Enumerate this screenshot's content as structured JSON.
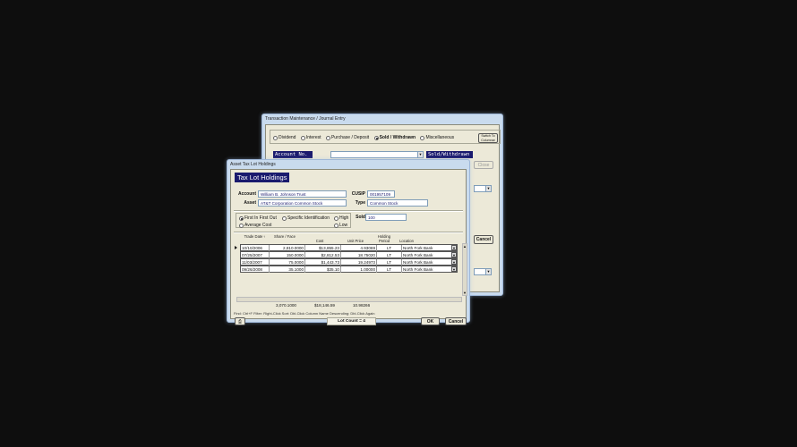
{
  "tm": {
    "title": "Transaction Maintenance / Journal Entry",
    "radios": [
      {
        "label": "Dividend",
        "on": false
      },
      {
        "label": "Interest",
        "on": false
      },
      {
        "label": "Purchase / Deposit",
        "on": false
      },
      {
        "label": "Sold / Withdrawn",
        "on": true
      },
      {
        "label": "Miscellaneous",
        "on": false
      }
    ],
    "switch_label": "Switch To Columnar",
    "account_label": "Account No.",
    "mode_label": "Sold/Withdrawn",
    "close_label": "Close",
    "cancel_label": "Cancel"
  },
  "tl": {
    "title": "Asset Tax Lot Holdings",
    "banner": "Tax Lot Holdings",
    "account_label": "Account",
    "account_value": "William B. Johnson Trust",
    "asset_label": "Asset",
    "asset_value": "AT&T Corporation Common Stock",
    "cusip_label": "CUSIP",
    "cusip_value": "001957109",
    "type_label": "Type",
    "type_value": "Common Stock",
    "method_radios": [
      {
        "label": "First In First Out",
        "on": true
      },
      {
        "label": "Specific Identification",
        "on": false
      },
      {
        "label": "Average Cost",
        "on": false
      }
    ],
    "hl_radios": [
      {
        "label": "High",
        "on": false
      },
      {
        "label": "Low",
        "on": false
      }
    ],
    "sold_label": "Sold",
    "sold_value": "100",
    "headers": {
      "trade_date": "Trade Date",
      "share_face": "Share / Face",
      "cost": "Cost",
      "unit_price": "Unit Price",
      "holding_period": "Holding Period",
      "location": "Location"
    },
    "rows": [
      {
        "date": "10/10/2006",
        "shares": "2,810.0000",
        "cost": "$13,855.23",
        "price": "4.93069",
        "period": "LT",
        "location": "North Fork Bank"
      },
      {
        "date": "07/25/2007",
        "shares": "150.0000",
        "cost": "$2,812.53",
        "price": "18.75020",
        "period": "LT",
        "location": "North Fork Bank"
      },
      {
        "date": "11/03/2007",
        "shares": "75.0000",
        "cost": "$1,443.73",
        "price": "19.24973",
        "period": "LT",
        "location": "North Fork Bank"
      },
      {
        "date": "09/26/2008",
        "shares": "35.1000",
        "cost": "$35.10",
        "price": "1.00000",
        "period": "LT",
        "location": "North Fork Bank"
      }
    ],
    "totals": {
      "shares": "3,070.1000",
      "cost": "$18,146.59",
      "price": "10.98266"
    },
    "hint": "Find: Ctrl+F    Filter: Right-Click    Sort: Dbl-Click Column Name    Descending: Dbl-Click Again",
    "lot_count": "Lot Count = 4",
    "ok_label": "OK",
    "cancel_label": "Cancel"
  }
}
